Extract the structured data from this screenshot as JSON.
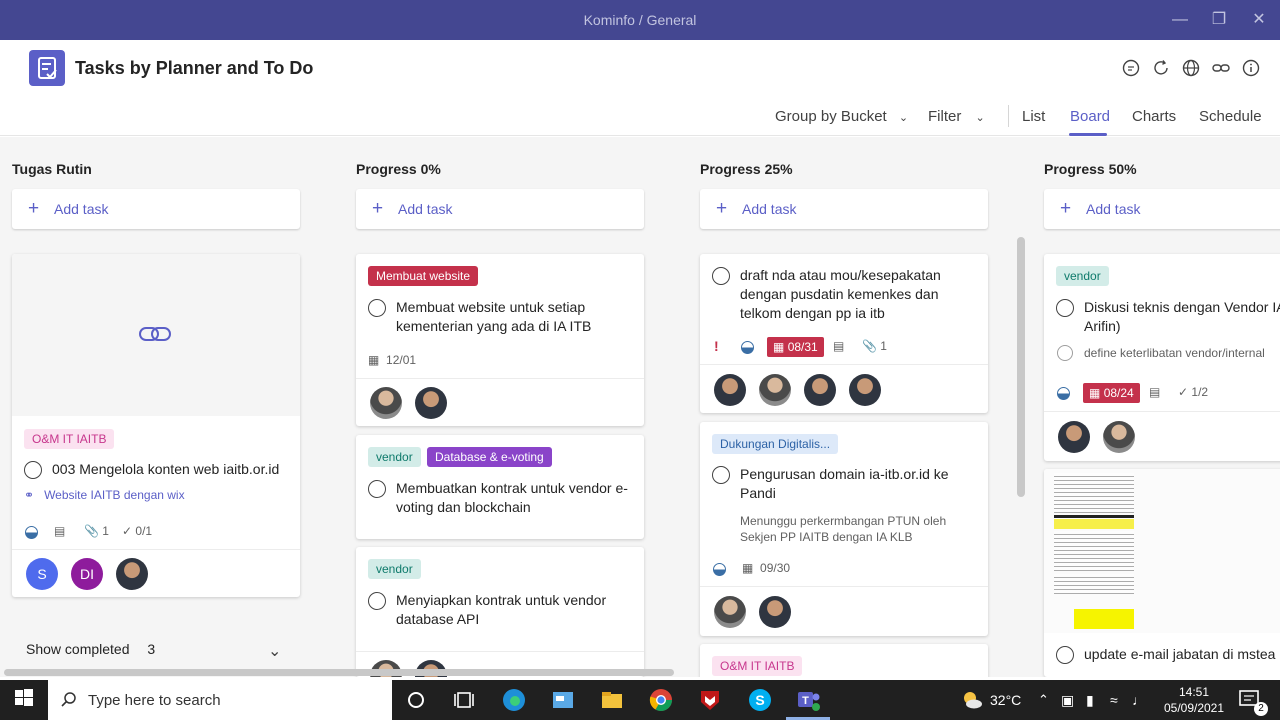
{
  "window": {
    "title": "Kominfo / General"
  },
  "app": {
    "name": "Tasks by Planner and To Do"
  },
  "toolbar": {
    "group_by": "Group by Bucket",
    "filter": "Filter",
    "views": [
      "List",
      "Board",
      "Charts",
      "Schedule"
    ],
    "active_view": "Board"
  },
  "buckets": [
    {
      "name": "Tugas Rutin",
      "add_task": "Add task",
      "cards": [
        {
          "label": "O&M IT IAITB",
          "title": "003 Mengelola konten web iaitb.or.id",
          "link": "Website IAITB dengan wix",
          "attachments": "1",
          "checklist": "0/1",
          "avatars": [
            "S",
            "DI"
          ]
        }
      ],
      "show_completed": "Show completed",
      "completed_count": "3"
    },
    {
      "name": "Progress 0%",
      "add_task": "Add task",
      "cards": [
        {
          "labels": [
            "Membuat website"
          ],
          "title": "Membuat website untuk setiap kementerian yang ada di IA ITB",
          "date": "12/01"
        },
        {
          "labels": [
            "vendor",
            "Database & e-voting"
          ],
          "title": "Membuatkan kontrak untuk vendor e-voting dan blockchain"
        },
        {
          "labels": [
            "vendor"
          ],
          "title": "Menyiapkan kontrak untuk vendor database API"
        }
      ]
    },
    {
      "name": "Progress 25%",
      "add_task": "Add task",
      "cards": [
        {
          "title": "draft nda atau mou/kesepakatan dengan pusdatin kemenkes dan telkom dengan pp ia itb",
          "priority": "!",
          "date": "08/31",
          "attachments": "1"
        },
        {
          "labels": [
            "Dukungan Digitalis..."
          ],
          "title": "Pengurusan domain ia-itb.or.id ke Pandi",
          "note": "Menunggu perkermbangan PTUN oleh Sekjen PP IAITB dengan IA KLB",
          "date": "09/30"
        },
        {
          "labels": [
            "O&M IT IAITB"
          ]
        }
      ]
    },
    {
      "name": "Progress 50%",
      "add_task": "Add task",
      "cards": [
        {
          "labels": [
            "vendor"
          ],
          "title": "Diskusi teknis dengan Vendor IA (Kang Arifin)",
          "subtask": "define keterlibatan vendor/internal",
          "date": "08/24",
          "checklist": "1/2"
        },
        {
          "title": "update e-mail jabatan di mstea"
        }
      ]
    }
  ],
  "taskbar": {
    "search_placeholder": "Type here to search",
    "temperature": "32°C",
    "time": "14:51",
    "date": "05/09/2021",
    "notifications": "2"
  },
  "colors": {
    "brand": "#5b5fc7",
    "titlebar": "#444791",
    "tag_pink_bg": "#fbe2f0",
    "tag_pink_fg": "#c7378d",
    "tag_red": "#c4314b",
    "tag_teal_bg": "#d3ece8",
    "tag_teal_fg": "#0e7a6b",
    "tag_purple": "#8a44c9",
    "tag_blue_bg": "#dde9f9",
    "tag_blue_fg": "#2d62a6"
  }
}
